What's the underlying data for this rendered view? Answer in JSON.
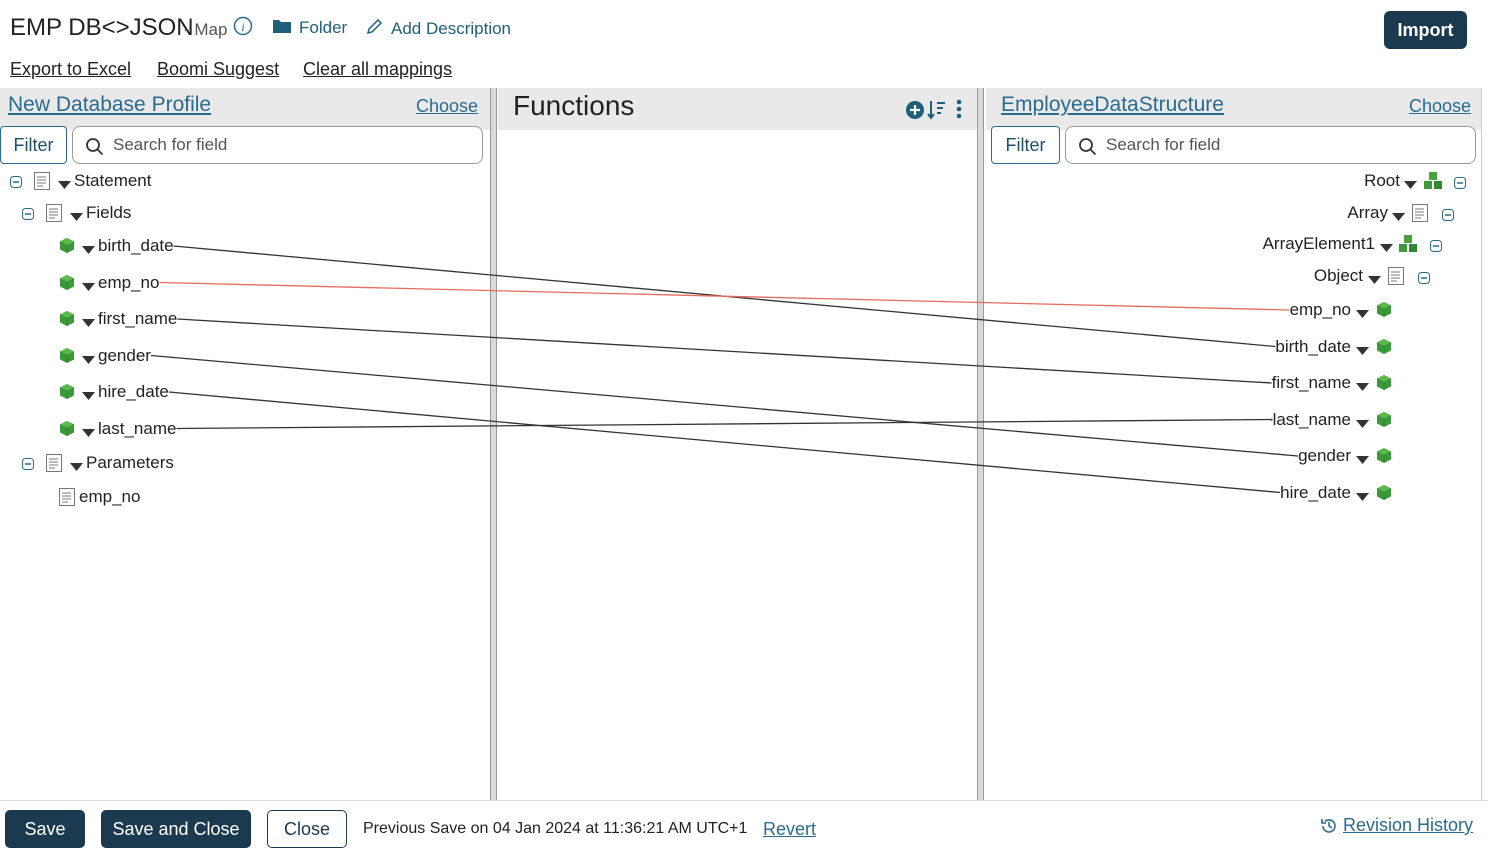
{
  "header": {
    "title": "EMP DB<>JSON",
    "subtitle": "- Map",
    "folder_label": "Folder",
    "add_description_label": "Add Description",
    "import_label": "Import"
  },
  "toolbar": {
    "export_label": "Export to Excel",
    "suggest_label": "Boomi Suggest",
    "clear_label": "Clear all mappings"
  },
  "source": {
    "title": "New Database Profile",
    "choose_label": "Choose",
    "filter_label": "Filter",
    "search_placeholder": "Search for field",
    "statement_label": "Statement",
    "fields_label": "Fields",
    "fields": [
      "birth_date",
      "emp_no",
      "first_name",
      "gender",
      "hire_date",
      "last_name"
    ],
    "parameters_label": "Parameters",
    "param_field": "emp_no"
  },
  "functions": {
    "title": "Functions"
  },
  "destination": {
    "title": "EmployeeDataStructure",
    "choose_label": "Choose",
    "filter_label": "Filter",
    "search_placeholder": "Search for field",
    "root_label": "Root",
    "array_label": "Array",
    "array_element_label": "ArrayElement1",
    "object_label": "Object",
    "fields": [
      "emp_no",
      "birth_date",
      "first_name",
      "last_name",
      "gender",
      "hire_date"
    ]
  },
  "mappings": [
    {
      "from": "birth_date",
      "to": "birth_date",
      "color": "#333333"
    },
    {
      "from": "emp_no",
      "to": "emp_no",
      "color": "#e86b60"
    },
    {
      "from": "first_name",
      "to": "first_name",
      "color": "#333333"
    },
    {
      "from": "gender",
      "to": "gender",
      "color": "#333333"
    },
    {
      "from": "hire_date",
      "to": "hire_date",
      "color": "#333333"
    },
    {
      "from": "last_name",
      "to": "last_name",
      "color": "#333333"
    }
  ],
  "footer": {
    "save_label": "Save",
    "save_close_label": "Save and Close",
    "close_label": "Close",
    "previous_save": "Previous Save on 04 Jan 2024 at 11:36:21 AM UTC+1",
    "revert_label": "Revert",
    "revision_history_label": "Revision History"
  },
  "colors": {
    "primary_dark": "#1b3a4f",
    "link": "#2a6b8f",
    "mapping_selected": "#e86b60",
    "field_icon_green": "#3a9a3a"
  },
  "icons": [
    "info-icon",
    "folder-icon",
    "pencil-icon",
    "search-icon",
    "add-function-icon",
    "sort-icon",
    "more-icon",
    "collapse-icon",
    "element-icon",
    "field-cube-icon",
    "group-cubes-icon",
    "history-icon"
  ]
}
